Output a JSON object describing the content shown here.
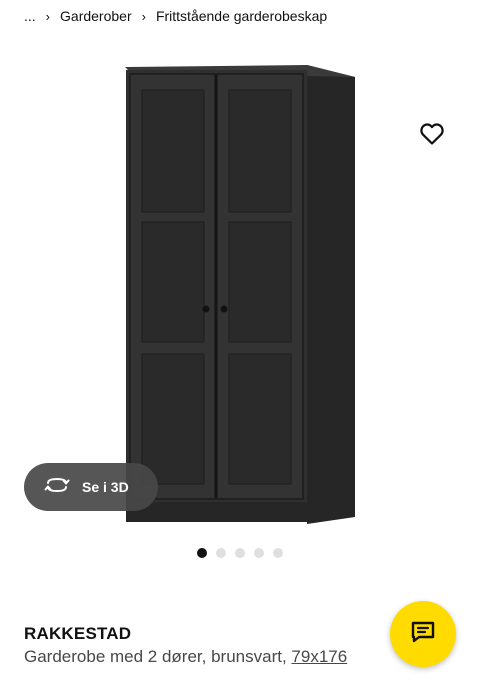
{
  "breadcrumb": {
    "items": [
      "...",
      "Garderober",
      "Frittstående garderobeskap"
    ]
  },
  "media": {
    "view_3d_label": "Se i 3D",
    "image_count": 5,
    "active_index": 0
  },
  "product": {
    "name": "RAKKESTAD",
    "description": "Garderobe med 2 dører, brunsvart, ",
    "dimensions": "79x176"
  },
  "colors": {
    "accent": "#ffdb00",
    "wardrobe": "#2e2e2e",
    "text": "#111111"
  }
}
